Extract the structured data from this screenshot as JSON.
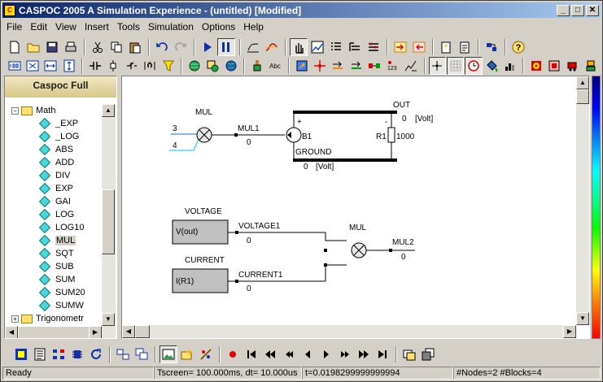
{
  "window": {
    "title": "CASPOC 2005 A Simulation Experience - (untitled) [Modified]",
    "app_icon": "caspoc-app-icon"
  },
  "menubar": {
    "items": [
      "File",
      "Edit",
      "View",
      "Insert",
      "Tools",
      "Simulation",
      "Options",
      "Help"
    ]
  },
  "left_panel": {
    "header": "Caspoc Full",
    "tree": [
      {
        "label": "Math",
        "type": "folder",
        "expanded": true
      },
      {
        "label": "_EXP",
        "type": "block"
      },
      {
        "label": "_LOG",
        "type": "block"
      },
      {
        "label": "ABS",
        "type": "block"
      },
      {
        "label": "ADD",
        "type": "block"
      },
      {
        "label": "DIV",
        "type": "block"
      },
      {
        "label": "EXP",
        "type": "block"
      },
      {
        "label": "GAI",
        "type": "block"
      },
      {
        "label": "LOG",
        "type": "block"
      },
      {
        "label": "LOG10",
        "type": "block"
      },
      {
        "label": "MUL",
        "type": "block",
        "selected": true
      },
      {
        "label": "SQT",
        "type": "block"
      },
      {
        "label": "SUB",
        "type": "block"
      },
      {
        "label": "SUM",
        "type": "block"
      },
      {
        "label": "SUM20",
        "type": "block"
      },
      {
        "label": "SUMW",
        "type": "block"
      },
      {
        "label": "Trigonometr",
        "type": "folder",
        "expanded": false
      }
    ]
  },
  "circuit": {
    "mul_top": {
      "label": "MUL",
      "in1": "3",
      "in2": "4",
      "out_node": "MUL1",
      "out_value": "0"
    },
    "out_block": {
      "label": "OUT",
      "value": "0",
      "unit": "[Volt]",
      "source": "B1",
      "plus": "+",
      "minus": "-",
      "resistor": "R1",
      "resistor_value": "1000",
      "ground": "GROUND",
      "ground_value": "0",
      "ground_unit": "[Volt]"
    },
    "voltage": {
      "title": "VOLTAGE",
      "expr": "V(out)",
      "node": "VOLTAGE1",
      "value": "0"
    },
    "current": {
      "title": "CURRENT",
      "expr": "I(R1)",
      "node": "CURRENT1",
      "value": "0"
    },
    "mul_bottom": {
      "label": "MUL",
      "node": "MUL2",
      "value": "0"
    }
  },
  "status": {
    "ready": "Ready",
    "tscreen": "Tscreen= 100.000ms, dt= 10.000us",
    "time": "t=0.0198299999999994",
    "counts": "#Nodes=2 #Blocks=4"
  }
}
